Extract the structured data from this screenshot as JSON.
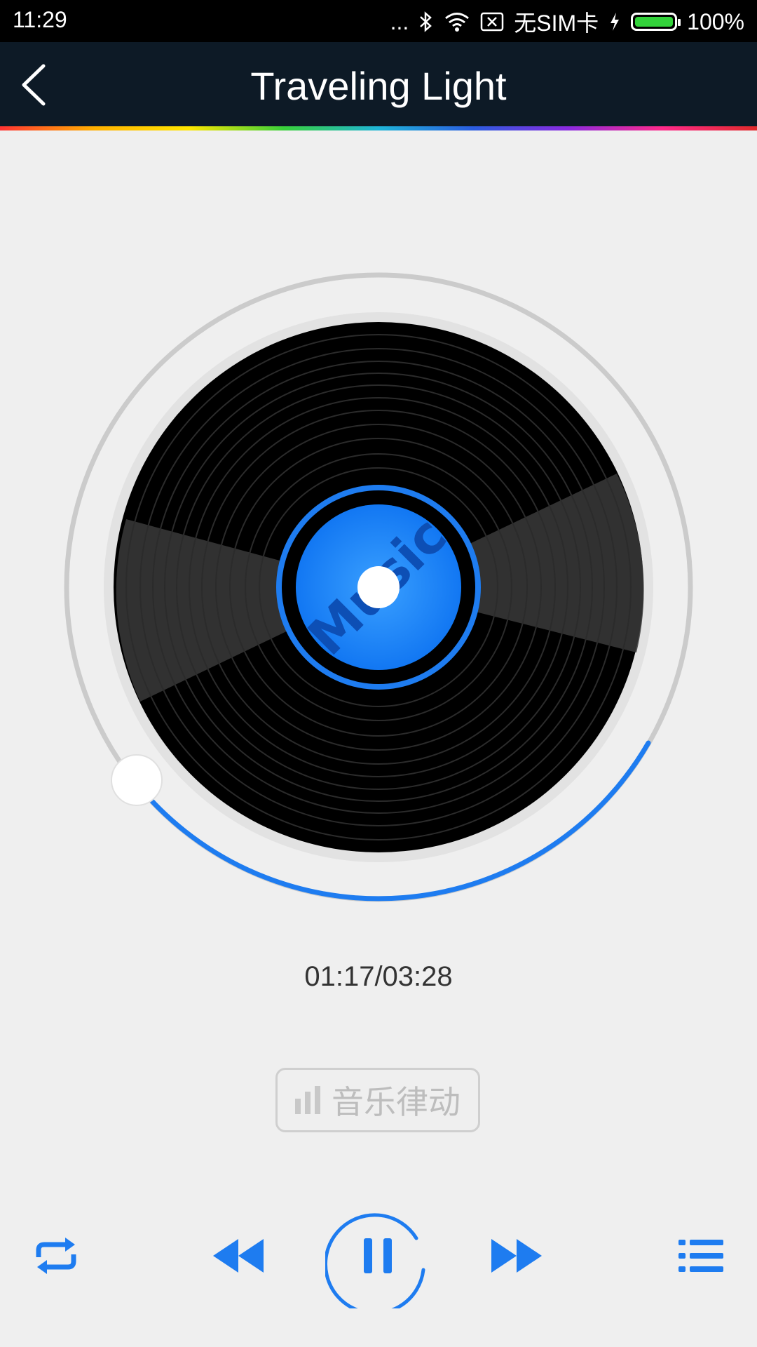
{
  "status_bar": {
    "time": "11:29",
    "dots": "...",
    "carrier": "无SIM卡",
    "battery": "100%"
  },
  "header": {
    "title": "Traveling Light",
    "back_icon": "chevron-left-icon"
  },
  "player": {
    "elapsed": "01:17",
    "duration": "03:28",
    "time_display": "01:17/03:28",
    "progress_fraction": 0.37,
    "disc_label": "Music",
    "rhythm_label": "音乐律动"
  },
  "controls": {
    "repeat_icon": "repeat-icon",
    "prev_icon": "rewind-icon",
    "play_pause_icon": "pause-icon",
    "next_icon": "fast-forward-icon",
    "playlist_icon": "playlist-icon"
  },
  "colors": {
    "accent": "#1e7cf0",
    "header_bg": "#0d1a26",
    "background": "#efefef"
  }
}
